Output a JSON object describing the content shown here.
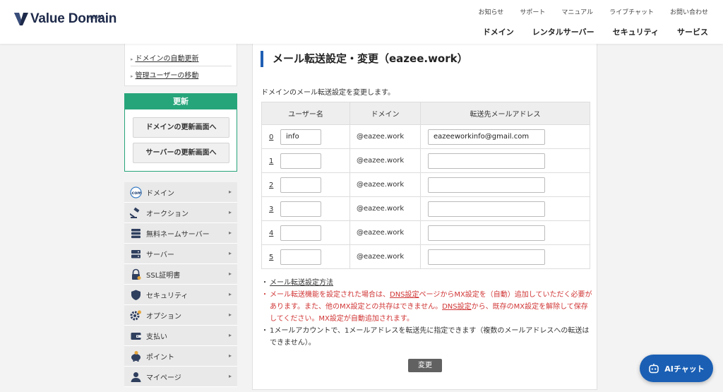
{
  "brand": {
    "name": "Value Domain",
    "by": "by",
    "by_brand": "GMO",
    "accent": "#1f5fb5",
    "green": "#27a57a"
  },
  "topnav": [
    "お知らせ",
    "サポート",
    "マニュアル",
    "ライブチャット",
    "お問い合わせ"
  ],
  "mainnav": [
    "ドメイン",
    "レンタルサーバー",
    "セキュリティ",
    "サービス"
  ],
  "sidebar": {
    "links": [
      "ドメインの自動更新",
      "管理ユーザーの移動"
    ],
    "renew": {
      "title": "更新",
      "domain_btn": "ドメインの更新画面へ",
      "server_btn": "サーバーの更新画面へ"
    },
    "menu": [
      {
        "label": "ドメイン",
        "icon": "dotcom-icon"
      },
      {
        "label": "オークション",
        "icon": "gavel-icon"
      },
      {
        "label": "無料ネームサーバー",
        "icon": "server-stack-icon"
      },
      {
        "label": "サーバー",
        "icon": "server-icon"
      },
      {
        "label": "SSL証明書",
        "icon": "lock-icon"
      },
      {
        "label": "セキュリティ",
        "icon": "shield-icon"
      },
      {
        "label": "オプション",
        "icon": "gear-icon"
      },
      {
        "label": "支払い",
        "icon": "wallet-icon"
      },
      {
        "label": "ポイント",
        "icon": "piggy-bank-icon"
      },
      {
        "label": "マイページ",
        "icon": "user-icon"
      }
    ]
  },
  "main": {
    "title": "メール転送設定・変更（eazee.work）",
    "description": "ドメインのメール転送設定を変更します。",
    "table": {
      "headers": [
        "ユーザー名",
        "ドメイン",
        "転送先メールアドレス"
      ],
      "rows": [
        {
          "index": "0",
          "user": "info",
          "domain": "@eazee.work",
          "forward": "eazeeworkinfo@gmail.com"
        },
        {
          "index": "1",
          "user": "",
          "domain": "@eazee.work",
          "forward": ""
        },
        {
          "index": "2",
          "user": "",
          "domain": "@eazee.work",
          "forward": ""
        },
        {
          "index": "3",
          "user": "",
          "domain": "@eazee.work",
          "forward": ""
        },
        {
          "index": "4",
          "user": "",
          "domain": "@eazee.work",
          "forward": ""
        },
        {
          "index": "5",
          "user": "",
          "domain": "@eazee.work",
          "forward": ""
        }
      ]
    },
    "notes": {
      "howto_link": "メール転送設定方法",
      "red_1": "メール転送機能を設定された場合は、",
      "red_link_1": "DNS設定",
      "red_2": "ページからMX設定を（自動）追加していただく必要があります。また、他のMX設定との共存はできません。",
      "red_link_2": "DNS設定",
      "red_3": "から、既存のMX設定を解除して保存してください。MX設定が自動追加されます。",
      "info": "1メールアカウントで、1メールアドレスを転送先に指定できます（複数のメールアドレスへの転送はできません）。"
    },
    "submit_label": "変更"
  },
  "ai_chat": {
    "label": "AIチャット"
  }
}
